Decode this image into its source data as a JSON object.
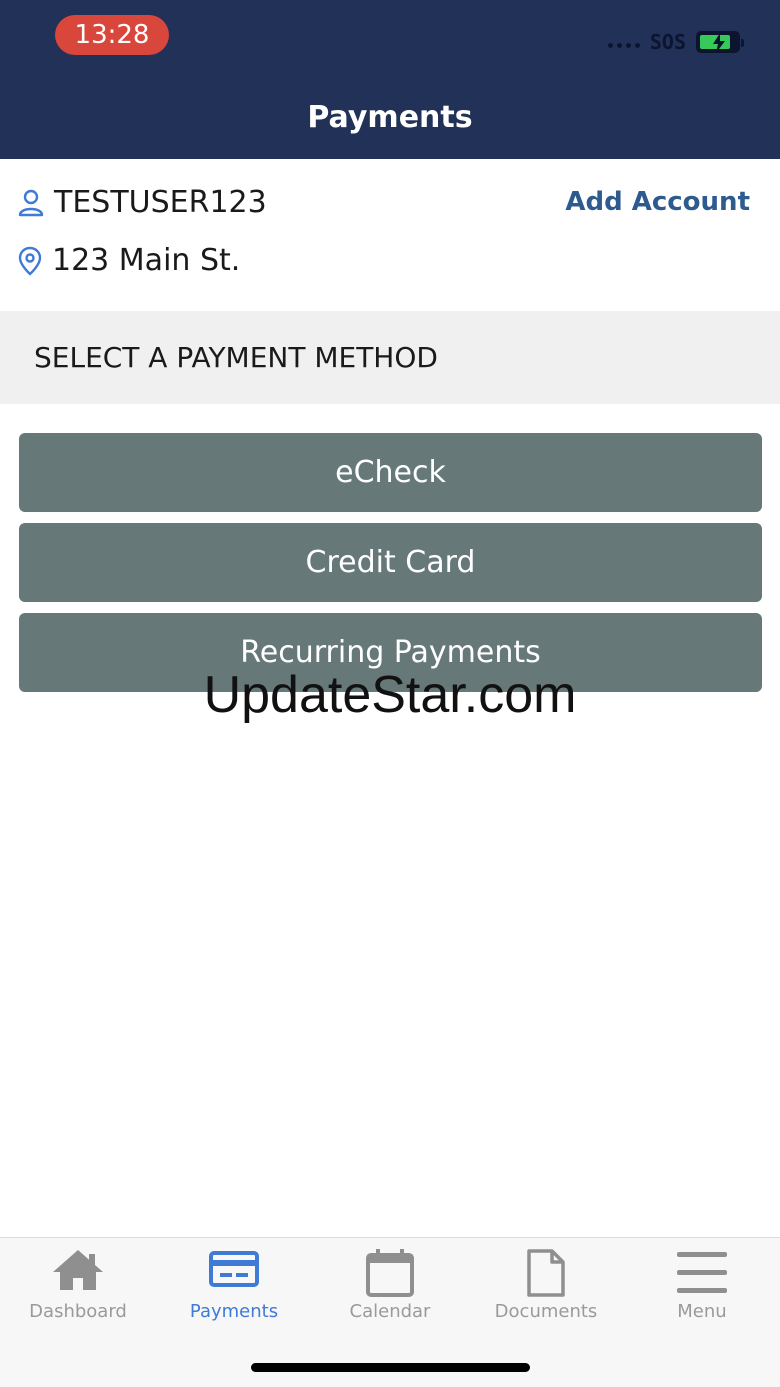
{
  "status": {
    "time": "13:28",
    "carrier": "SOS"
  },
  "header": {
    "title": "Payments"
  },
  "account": {
    "username": "TESTUSER123",
    "address": "123 Main St.",
    "add_account_label": "Add Account"
  },
  "section": {
    "title": "SELECT A PAYMENT METHOD"
  },
  "payment_methods": [
    "eCheck",
    "Credit Card",
    "Recurring Payments"
  ],
  "watermark": "UpdateStar.com",
  "tabs": [
    {
      "label": "Dashboard",
      "icon": "home-icon"
    },
    {
      "label": "Payments",
      "icon": "card-icon",
      "active": true
    },
    {
      "label": "Calendar",
      "icon": "calendar-icon"
    },
    {
      "label": "Documents",
      "icon": "document-icon"
    },
    {
      "label": "Menu",
      "icon": "menu-icon"
    }
  ],
  "colors": {
    "header": "#223158",
    "accent": "#3f7ad6",
    "button": "#667878",
    "time_pill": "#d9463b"
  }
}
